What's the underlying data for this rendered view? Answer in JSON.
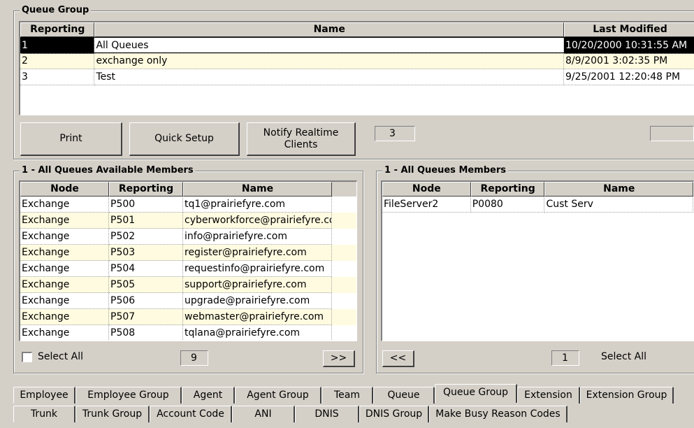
{
  "queue_group": {
    "title": "Queue Group",
    "columns": [
      "Reporting",
      "Name",
      "Last Modified"
    ],
    "rows": [
      {
        "reporting": "1",
        "name": "All Queues",
        "modified": "10/20/2000 10:31:55 AM"
      },
      {
        "reporting": "2",
        "name": "exchange only",
        "modified": "8/9/2001 3:02:35 PM"
      },
      {
        "reporting": "3",
        "name": "Test",
        "modified": "9/25/2001 12:20:48 PM"
      }
    ],
    "buttons": {
      "print": "Print",
      "quick_setup": "Quick Setup",
      "notify": "Notify Realtime Clients"
    },
    "count": "3",
    "extra_field": ""
  },
  "available": {
    "title": "1 - All Queues Available Members",
    "columns": [
      "Node",
      "Reporting",
      "Name"
    ],
    "rows": [
      {
        "node": "Exchange",
        "reporting": "P500",
        "name": "tq1@prairiefyre.com"
      },
      {
        "node": "Exchange",
        "reporting": "P501",
        "name": "cyberworkforce@prairiefyre.com"
      },
      {
        "node": "Exchange",
        "reporting": "P502",
        "name": "info@prairiefyre.com"
      },
      {
        "node": "Exchange",
        "reporting": "P503",
        "name": "register@prairiefyre.com"
      },
      {
        "node": "Exchange",
        "reporting": "P504",
        "name": "requestinfo@prairiefyre.com"
      },
      {
        "node": "Exchange",
        "reporting": "P505",
        "name": "support@prairiefyre.com"
      },
      {
        "node": "Exchange",
        "reporting": "P506",
        "name": "upgrade@prairiefyre.com"
      },
      {
        "node": "Exchange",
        "reporting": "P507",
        "name": "webmaster@prairiefyre.com"
      },
      {
        "node": "Exchange",
        "reporting": "P508",
        "name": "tqlana@prairiefyre.com"
      }
    ],
    "select_all": "Select All",
    "count": "9",
    "add_button": ">>"
  },
  "members": {
    "title": "1 - All Queues Members",
    "columns": [
      "Node",
      "Reporting",
      "Name"
    ],
    "rows": [
      {
        "node": "FileServer2",
        "reporting": "P0080",
        "name": "Cust Serv"
      }
    ],
    "remove_button": "<<",
    "count": "1",
    "select_all": "Select All"
  },
  "tabs": {
    "row1": [
      "Employee",
      "Employee Group",
      "Agent",
      "Agent Group",
      "Team",
      "Queue",
      "Queue Group",
      "Extension",
      "Extension Group"
    ],
    "row2": [
      "Trunk",
      "Trunk Group",
      "Account Code",
      "ANI",
      "DNIS",
      "DNIS Group",
      "Make Busy Reason Codes"
    ],
    "active": "Queue Group"
  }
}
